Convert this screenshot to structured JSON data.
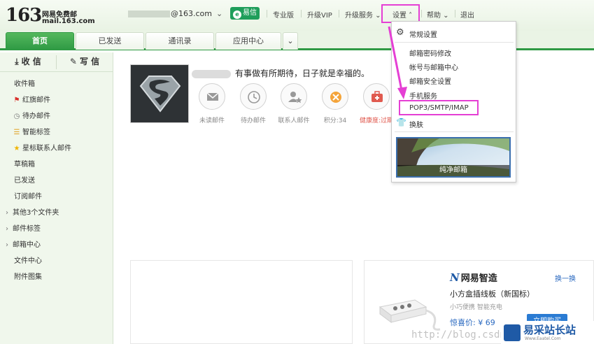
{
  "header": {
    "logo_number": "163",
    "logo_name": "网易免费邮",
    "logo_domain": "mail.163.com",
    "user_email": "@163.com",
    "yixin_label": "易信",
    "links": {
      "pro": "专业版",
      "vip": "升级VIP",
      "upgrade_service": "升级服务",
      "settings": "设置",
      "help": "帮助",
      "logout": "退出"
    }
  },
  "tabs": [
    {
      "label": "首页"
    },
    {
      "label": "已发送"
    },
    {
      "label": "通讯录"
    },
    {
      "label": "应用中心"
    }
  ],
  "sidebar": {
    "receive_label": "收 信",
    "write_label": "写 信",
    "items": [
      {
        "label": "收件箱"
      },
      {
        "label": "红旗邮件"
      },
      {
        "label": "待办邮件"
      },
      {
        "label": "智能标签"
      },
      {
        "label": "星标联系人邮件"
      },
      {
        "label": "草稿箱"
      },
      {
        "label": "已发送"
      },
      {
        "label": "订阅邮件"
      },
      {
        "label": "其他3个文件夹"
      },
      {
        "label": "邮件标签"
      },
      {
        "label": "邮箱中心"
      },
      {
        "label": "文件中心"
      },
      {
        "label": "附件图集"
      }
    ]
  },
  "main": {
    "greeting": "有事做有所期待，日子就是幸福的。",
    "stats": [
      {
        "label": "未读邮件"
      },
      {
        "label": "待办邮件"
      },
      {
        "label": "联系人邮件"
      },
      {
        "label": "积分:34"
      },
      {
        "label": "健康度:过期"
      }
    ]
  },
  "settings_menu": {
    "items": [
      {
        "label": "常规设置"
      },
      {
        "label": "邮箱密码修改"
      },
      {
        "label": "帐号与邮箱中心"
      },
      {
        "label": "邮箱安全设置"
      },
      {
        "label": "手机服务"
      },
      {
        "label": "POP3/SMTP/IMAP"
      },
      {
        "label": "换肤"
      }
    ],
    "skin_caption": "纯净邮箱"
  },
  "promo": {
    "brand": "网易智造",
    "brand_mark": "N",
    "swap": "换一换",
    "product_name": "小方盒插线板（新国标）",
    "product_tag": "小巧便携 智能充电",
    "price": "惊喜价: ¥ 69",
    "buy": "立即购买"
  },
  "watermark": {
    "url": "http://blog.csdn",
    "site_name": "易采站长站",
    "site_url": "Www.Eaatel.Com"
  },
  "colors": {
    "green": "#2f9a44",
    "highlight": "#e53fd4",
    "link_blue": "#2a69c0"
  }
}
